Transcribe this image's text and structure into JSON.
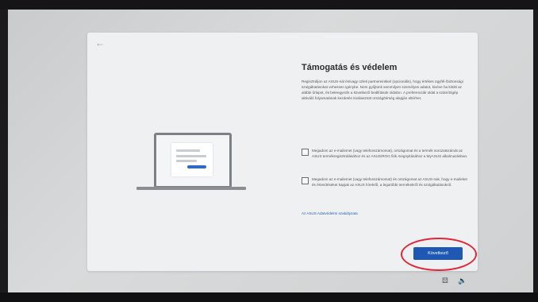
{
  "page": {
    "back_icon": "back-arrow-icon",
    "title": "Támogatás és védelem",
    "description": "Regisztráljon az ASUS-nál és/vagy üzleti partnereinkkel (opcionális), hogy értékes ügyfél-/biztonsági szolgáltatásokat vehessen igénybe. Nem gyűjtünk semmilyen személyes adatot, kivéve ha kitölti az alábbi űrlapot, és beleegyezik a következő beállítások oldalon. A preferenciák oldal a számítógép aktiváló folyamatának kezdetén kiválasztott ország/térség alapján eltérhet.",
    "options": [
      {
        "label": "Megadom az e-mailemet (vagy telefonszámomat), országomat és a termék sorozatszámát az ASUS termékregisztrálásához és az ASUS/ROG fiók megnyitásához a MyASUS alkalmazásban.",
        "checked": false
      },
      {
        "label": "Megadom az e-mailemet (vagy telefonszámomat) és országomat az ASUS-nak, hogy e-maileket és értesítéseket kapjak az ASUS hírekről, a legutóbbi termékekről és szolgáltatásokról.",
        "checked": false
      }
    ],
    "privacy_link": "Az ASUS Adatvédelmi szabályzata",
    "next_button": "Következő"
  },
  "tray": {
    "icons": [
      "accessibility-icon",
      "volume-icon"
    ]
  },
  "colors": {
    "accent": "#1e58b3",
    "annotation_circle": "#e2263a"
  }
}
